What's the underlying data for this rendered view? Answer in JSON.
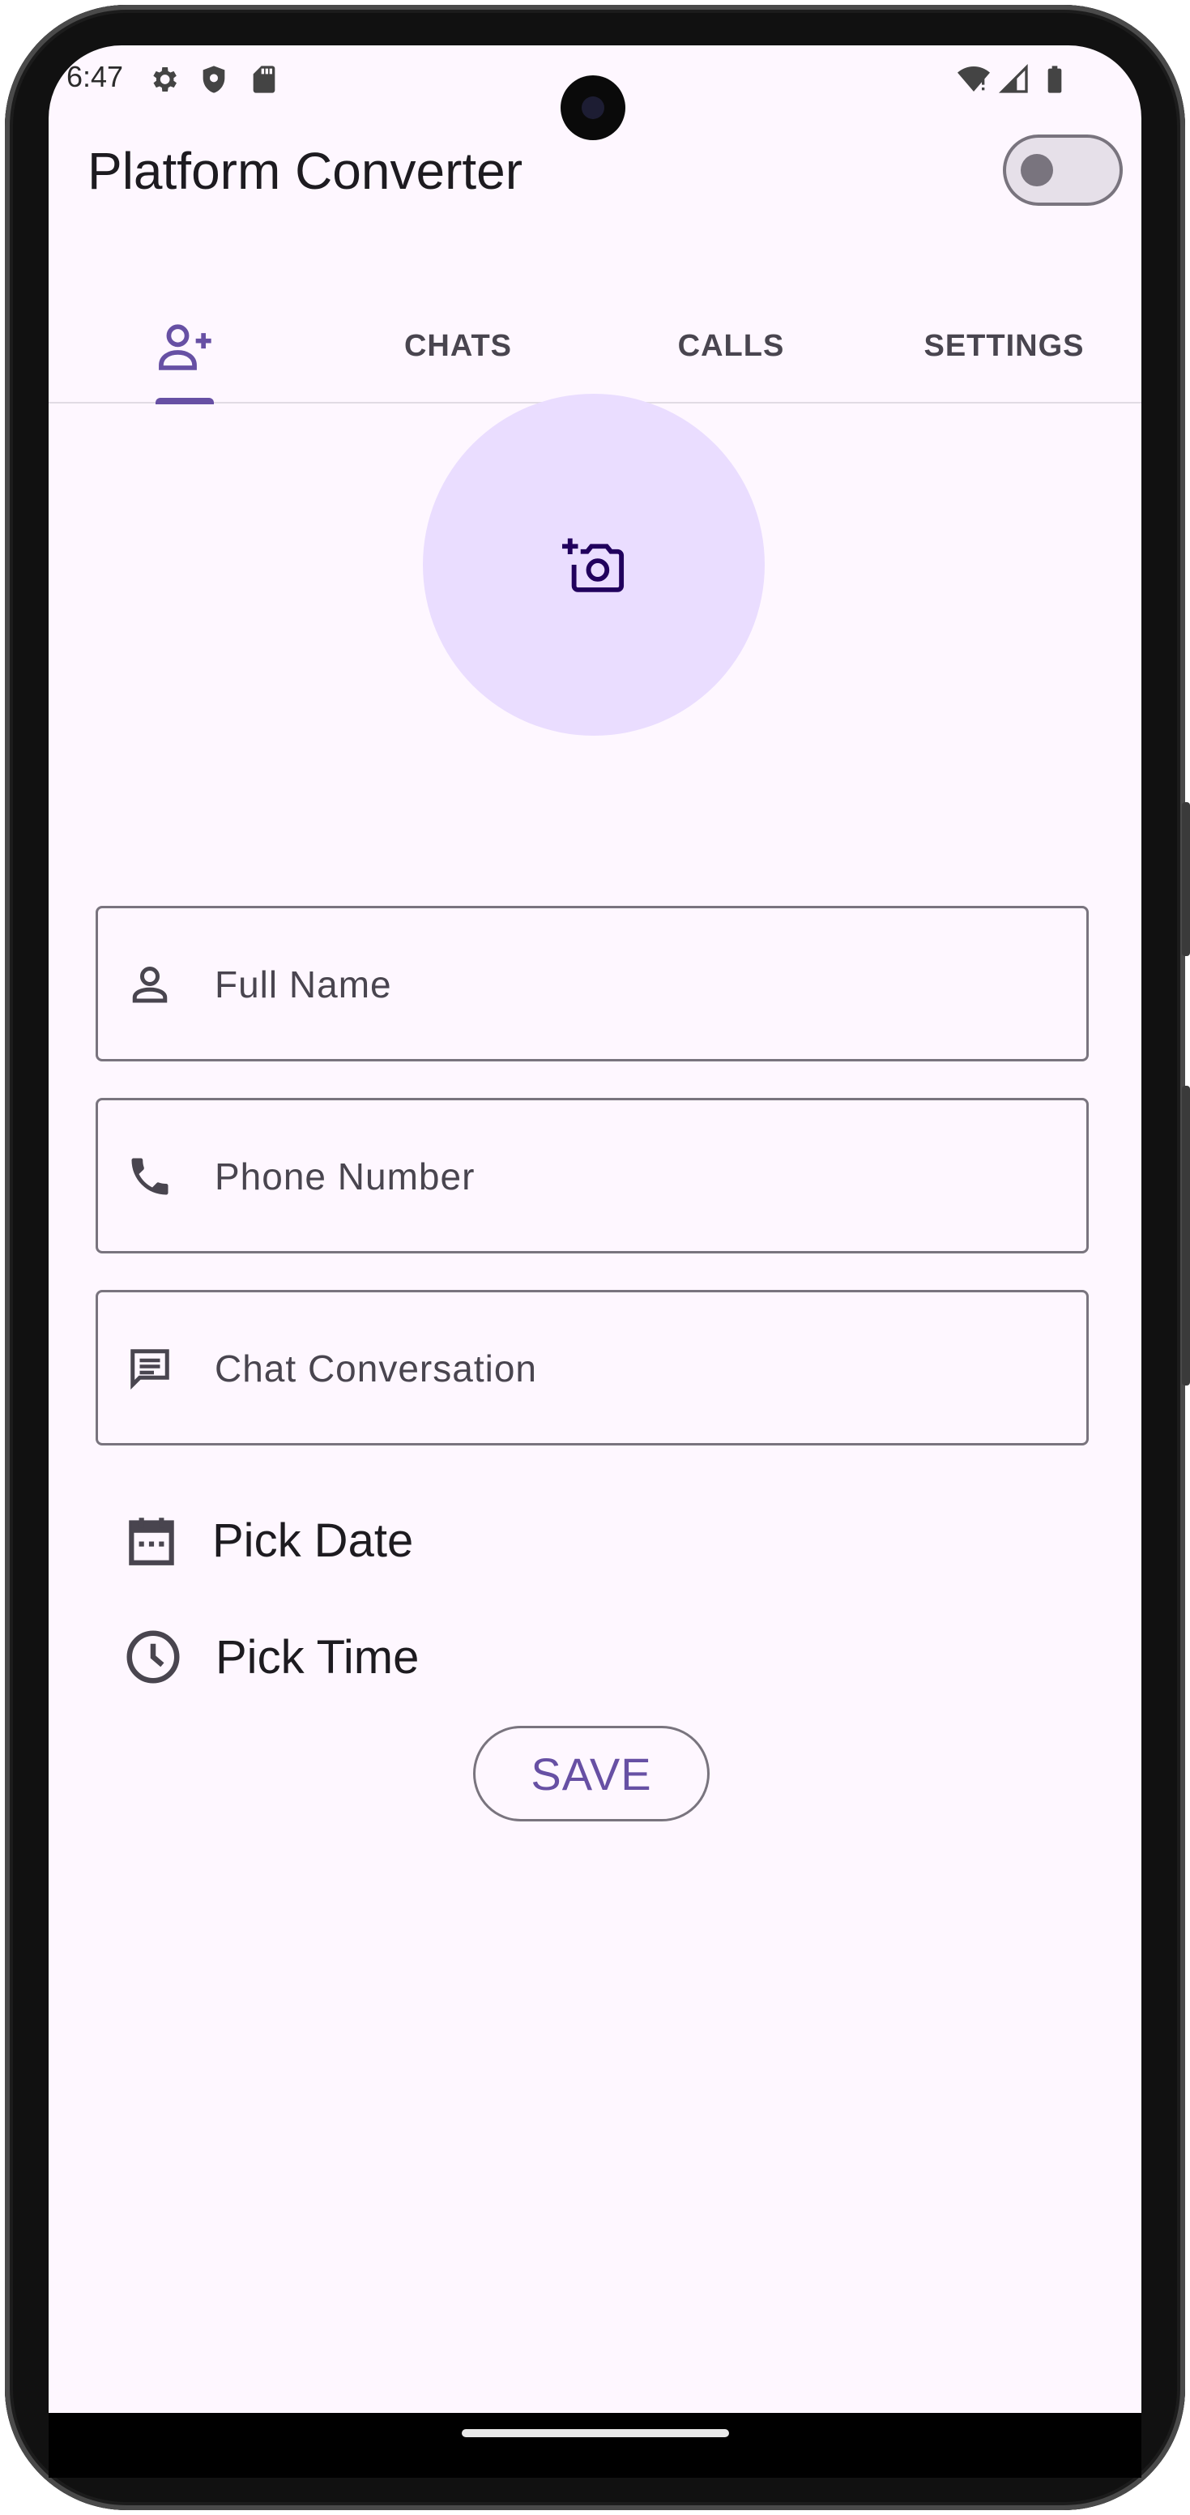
{
  "status_bar": {
    "time": "6:47",
    "icons": [
      "settings-icon",
      "shield-icon",
      "sd-card-icon",
      "wifi-icon",
      "cell-signal-icon",
      "battery-icon"
    ]
  },
  "app_bar": {
    "title": "Platform Converter",
    "toggle_on": false
  },
  "tabs": [
    {
      "label": "",
      "icon": "add-person-icon",
      "selected": true
    },
    {
      "label": "CHATS",
      "selected": false
    },
    {
      "label": "CALLS",
      "selected": false
    },
    {
      "label": "SETTINGS",
      "selected": false
    }
  ],
  "avatar": {
    "icon": "add-photo-icon"
  },
  "form": {
    "full_name": {
      "placeholder": "Full Name",
      "value": "",
      "icon": "person-icon"
    },
    "phone_number": {
      "placeholder": "Phone Number",
      "value": "",
      "icon": "phone-icon"
    },
    "chat_conversation": {
      "placeholder": "Chat Conversation",
      "value": "",
      "icon": "chat-icon"
    },
    "pick_date_label": "Pick Date",
    "pick_time_label": "Pick Time",
    "save_label": "SAVE"
  },
  "colors": {
    "primary": "#6750a4",
    "surface": "#fef7ff",
    "avatar_bg": "#eaddff",
    "outline": "#79747e",
    "on_surface": "#1d1b20"
  }
}
